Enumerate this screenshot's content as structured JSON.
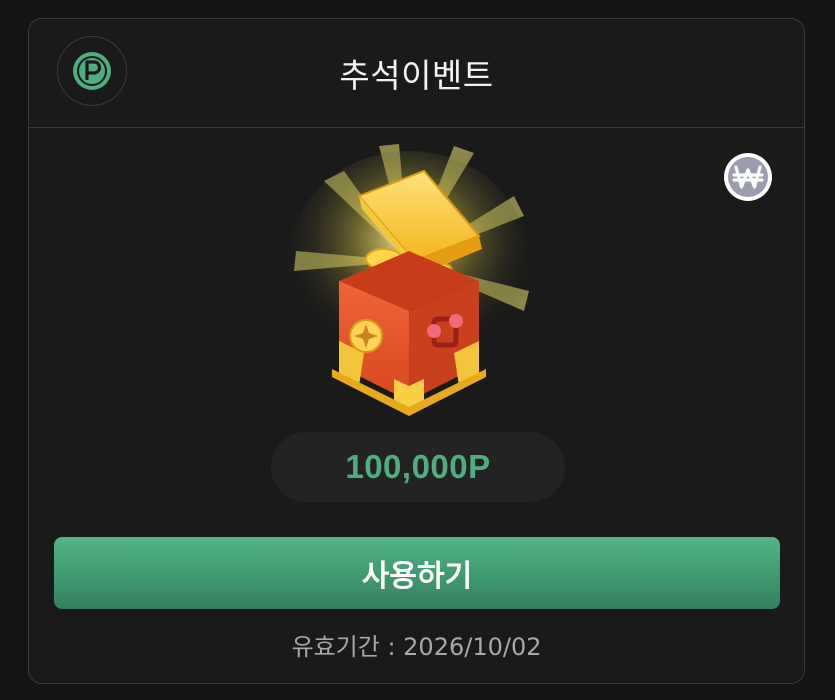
{
  "header": {
    "title": "추석이벤트",
    "point_icon": "point-coin-icon"
  },
  "reward": {
    "image": "treasure-chest-icon",
    "currency_icon": "won-currency-icon",
    "amount": "100,000P"
  },
  "action": {
    "use_label": "사용하기"
  },
  "validity": {
    "text": "유효기간 : 2026/10/02"
  },
  "colors": {
    "accent": "#4fae7f",
    "button": "#46a677",
    "background": "#1a1a1a",
    "border": "#3a3a3a"
  }
}
